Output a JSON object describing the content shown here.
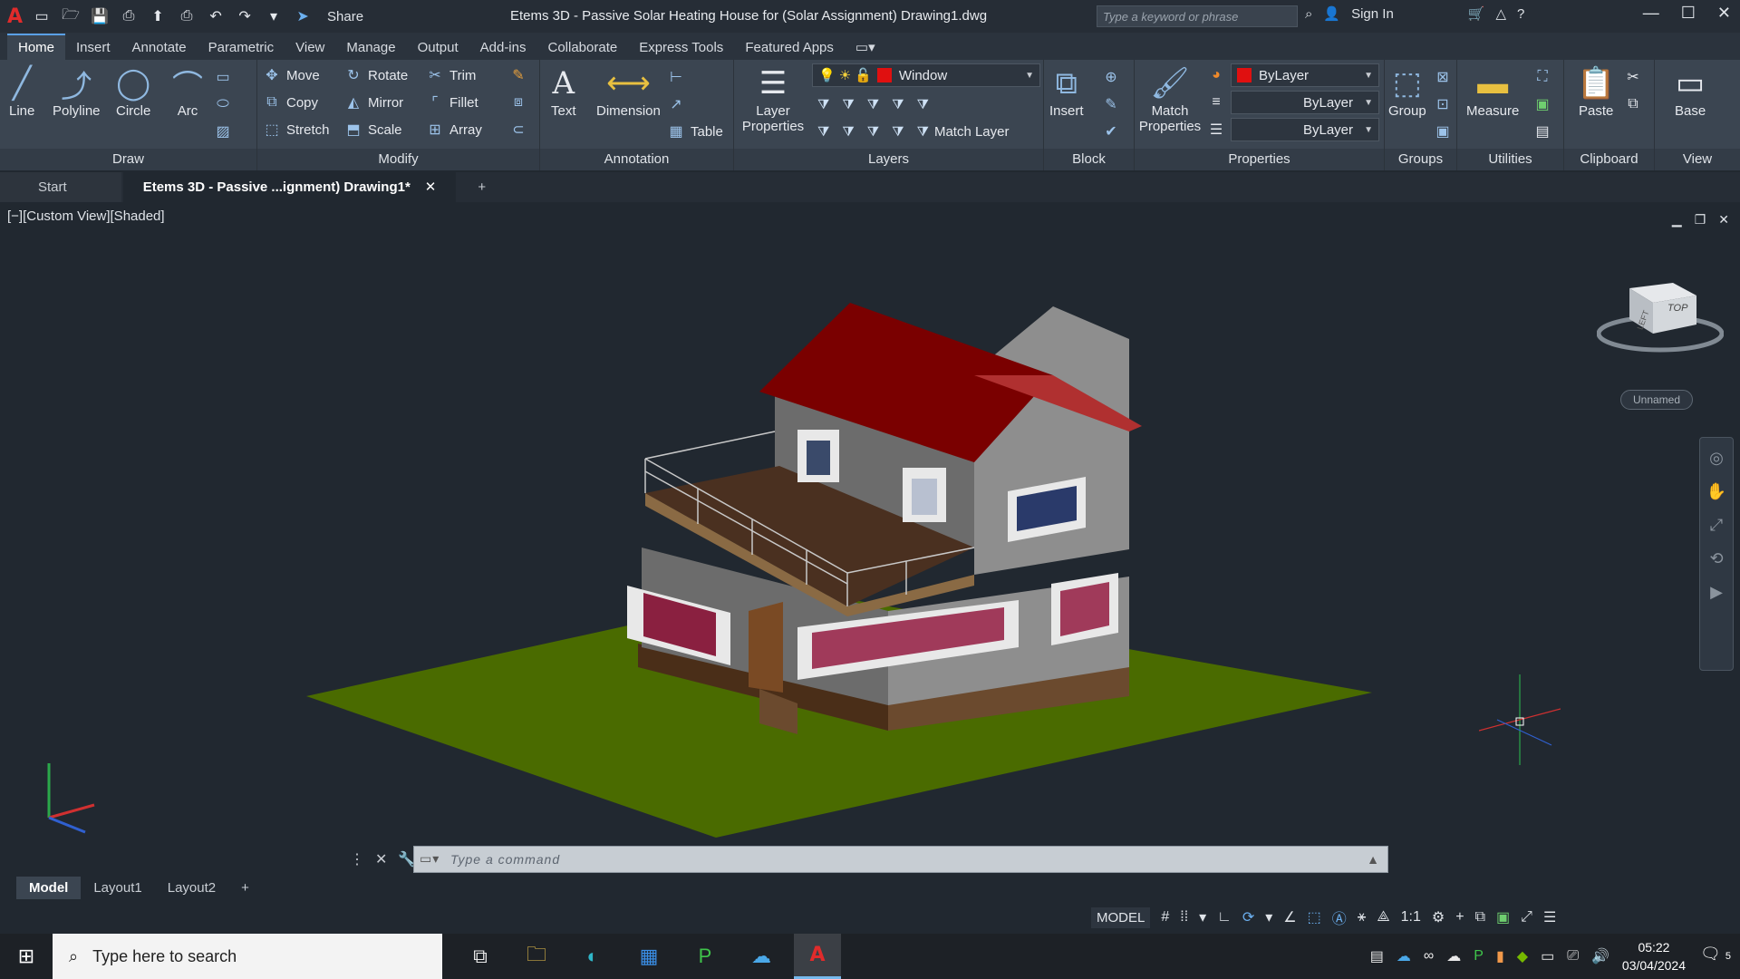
{
  "title_bar": {
    "share_label": "Share",
    "document_title": "Etems 3D - Passive Solar Heating House for (Solar Assignment)  Drawing1.dwg",
    "search_placeholder": "Type a keyword or phrase",
    "sign_in": "Sign In"
  },
  "ribbon_tabs": [
    "Home",
    "Insert",
    "Annotate",
    "Parametric",
    "View",
    "Manage",
    "Output",
    "Add-ins",
    "Collaborate",
    "Express Tools",
    "Featured Apps"
  ],
  "ribbon": {
    "draw": {
      "title": "Draw",
      "line": "Line",
      "polyline": "Polyline",
      "circle": "Circle",
      "arc": "Arc"
    },
    "modify": {
      "title": "Modify",
      "move": "Move",
      "rotate": "Rotate",
      "trim": "Trim",
      "copy": "Copy",
      "mirror": "Mirror",
      "fillet": "Fillet",
      "stretch": "Stretch",
      "scale": "Scale",
      "array": "Array"
    },
    "annotation": {
      "title": "Annotation",
      "text": "Text",
      "dimension": "Dimension",
      "table": "Table"
    },
    "layers": {
      "title": "Layers",
      "layer_properties": "Layer Properties",
      "current_layer": "Window",
      "match_layer": "Match Layer"
    },
    "block": {
      "title": "Block",
      "insert": "Insert"
    },
    "properties": {
      "title": "Properties",
      "match_properties": "Match Properties",
      "color": "ByLayer",
      "linetype": "ByLayer",
      "lineweight": "ByLayer"
    },
    "groups": {
      "title": "Groups",
      "group": "Group"
    },
    "utilities": {
      "title": "Utilities",
      "measure": "Measure"
    },
    "clipboard": {
      "title": "Clipboard",
      "paste": "Paste"
    },
    "view": {
      "title": "View",
      "base": "Base"
    }
  },
  "doc_tabs": {
    "start": "Start",
    "active": "Etems 3D - Passive ...ignment)  Drawing1*"
  },
  "viewport": {
    "label": "[−][Custom View][Shaded]",
    "view_name": "Unnamed",
    "cube_top": "TOP",
    "cube_left": "LEFT"
  },
  "command": {
    "placeholder": "Type  a  command"
  },
  "layout_tabs": [
    "Model",
    "Layout1",
    "Layout2"
  ],
  "status": {
    "model": "MODEL",
    "scale": "1:1"
  },
  "taskbar": {
    "search_placeholder": "Type here to search",
    "time": "05:22",
    "date": "03/04/2024",
    "notifications": "5"
  },
  "colors": {
    "accent": "#5aa0e6",
    "roof": "#8b0000",
    "ground": "#4a6b00",
    "layer_color": "#e01010"
  }
}
